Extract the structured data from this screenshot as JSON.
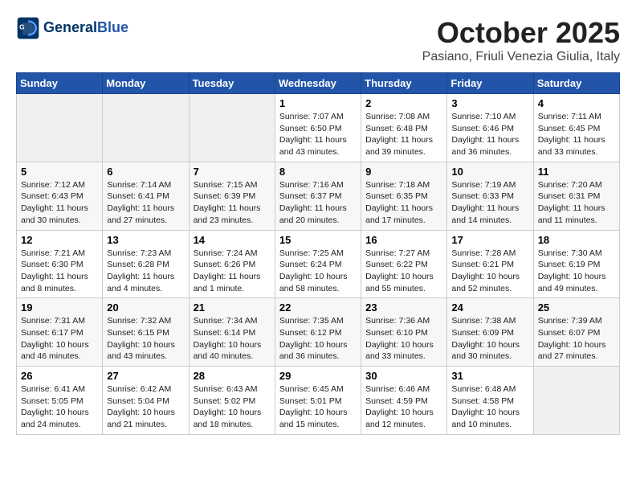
{
  "header": {
    "logo_line1": "General",
    "logo_line2": "Blue",
    "title": "October 2025",
    "subtitle": "Pasiano, Friuli Venezia Giulia, Italy"
  },
  "weekdays": [
    "Sunday",
    "Monday",
    "Tuesday",
    "Wednesday",
    "Thursday",
    "Friday",
    "Saturday"
  ],
  "weeks": [
    [
      {
        "day": "",
        "info": ""
      },
      {
        "day": "",
        "info": ""
      },
      {
        "day": "",
        "info": ""
      },
      {
        "day": "1",
        "info": "Sunrise: 7:07 AM\nSunset: 6:50 PM\nDaylight: 11 hours and 43 minutes."
      },
      {
        "day": "2",
        "info": "Sunrise: 7:08 AM\nSunset: 6:48 PM\nDaylight: 11 hours and 39 minutes."
      },
      {
        "day": "3",
        "info": "Sunrise: 7:10 AM\nSunset: 6:46 PM\nDaylight: 11 hours and 36 minutes."
      },
      {
        "day": "4",
        "info": "Sunrise: 7:11 AM\nSunset: 6:45 PM\nDaylight: 11 hours and 33 minutes."
      }
    ],
    [
      {
        "day": "5",
        "info": "Sunrise: 7:12 AM\nSunset: 6:43 PM\nDaylight: 11 hours and 30 minutes."
      },
      {
        "day": "6",
        "info": "Sunrise: 7:14 AM\nSunset: 6:41 PM\nDaylight: 11 hours and 27 minutes."
      },
      {
        "day": "7",
        "info": "Sunrise: 7:15 AM\nSunset: 6:39 PM\nDaylight: 11 hours and 23 minutes."
      },
      {
        "day": "8",
        "info": "Sunrise: 7:16 AM\nSunset: 6:37 PM\nDaylight: 11 hours and 20 minutes."
      },
      {
        "day": "9",
        "info": "Sunrise: 7:18 AM\nSunset: 6:35 PM\nDaylight: 11 hours and 17 minutes."
      },
      {
        "day": "10",
        "info": "Sunrise: 7:19 AM\nSunset: 6:33 PM\nDaylight: 11 hours and 14 minutes."
      },
      {
        "day": "11",
        "info": "Sunrise: 7:20 AM\nSunset: 6:31 PM\nDaylight: 11 hours and 11 minutes."
      }
    ],
    [
      {
        "day": "12",
        "info": "Sunrise: 7:21 AM\nSunset: 6:30 PM\nDaylight: 11 hours and 8 minutes."
      },
      {
        "day": "13",
        "info": "Sunrise: 7:23 AM\nSunset: 6:28 PM\nDaylight: 11 hours and 4 minutes."
      },
      {
        "day": "14",
        "info": "Sunrise: 7:24 AM\nSunset: 6:26 PM\nDaylight: 11 hours and 1 minute."
      },
      {
        "day": "15",
        "info": "Sunrise: 7:25 AM\nSunset: 6:24 PM\nDaylight: 10 hours and 58 minutes."
      },
      {
        "day": "16",
        "info": "Sunrise: 7:27 AM\nSunset: 6:22 PM\nDaylight: 10 hours and 55 minutes."
      },
      {
        "day": "17",
        "info": "Sunrise: 7:28 AM\nSunset: 6:21 PM\nDaylight: 10 hours and 52 minutes."
      },
      {
        "day": "18",
        "info": "Sunrise: 7:30 AM\nSunset: 6:19 PM\nDaylight: 10 hours and 49 minutes."
      }
    ],
    [
      {
        "day": "19",
        "info": "Sunrise: 7:31 AM\nSunset: 6:17 PM\nDaylight: 10 hours and 46 minutes."
      },
      {
        "day": "20",
        "info": "Sunrise: 7:32 AM\nSunset: 6:15 PM\nDaylight: 10 hours and 43 minutes."
      },
      {
        "day": "21",
        "info": "Sunrise: 7:34 AM\nSunset: 6:14 PM\nDaylight: 10 hours and 40 minutes."
      },
      {
        "day": "22",
        "info": "Sunrise: 7:35 AM\nSunset: 6:12 PM\nDaylight: 10 hours and 36 minutes."
      },
      {
        "day": "23",
        "info": "Sunrise: 7:36 AM\nSunset: 6:10 PM\nDaylight: 10 hours and 33 minutes."
      },
      {
        "day": "24",
        "info": "Sunrise: 7:38 AM\nSunset: 6:09 PM\nDaylight: 10 hours and 30 minutes."
      },
      {
        "day": "25",
        "info": "Sunrise: 7:39 AM\nSunset: 6:07 PM\nDaylight: 10 hours and 27 minutes."
      }
    ],
    [
      {
        "day": "26",
        "info": "Sunrise: 6:41 AM\nSunset: 5:05 PM\nDaylight: 10 hours and 24 minutes."
      },
      {
        "day": "27",
        "info": "Sunrise: 6:42 AM\nSunset: 5:04 PM\nDaylight: 10 hours and 21 minutes."
      },
      {
        "day": "28",
        "info": "Sunrise: 6:43 AM\nSunset: 5:02 PM\nDaylight: 10 hours and 18 minutes."
      },
      {
        "day": "29",
        "info": "Sunrise: 6:45 AM\nSunset: 5:01 PM\nDaylight: 10 hours and 15 minutes."
      },
      {
        "day": "30",
        "info": "Sunrise: 6:46 AM\nSunset: 4:59 PM\nDaylight: 10 hours and 12 minutes."
      },
      {
        "day": "31",
        "info": "Sunrise: 6:48 AM\nSunset: 4:58 PM\nDaylight: 10 hours and 10 minutes."
      },
      {
        "day": "",
        "info": ""
      }
    ]
  ]
}
